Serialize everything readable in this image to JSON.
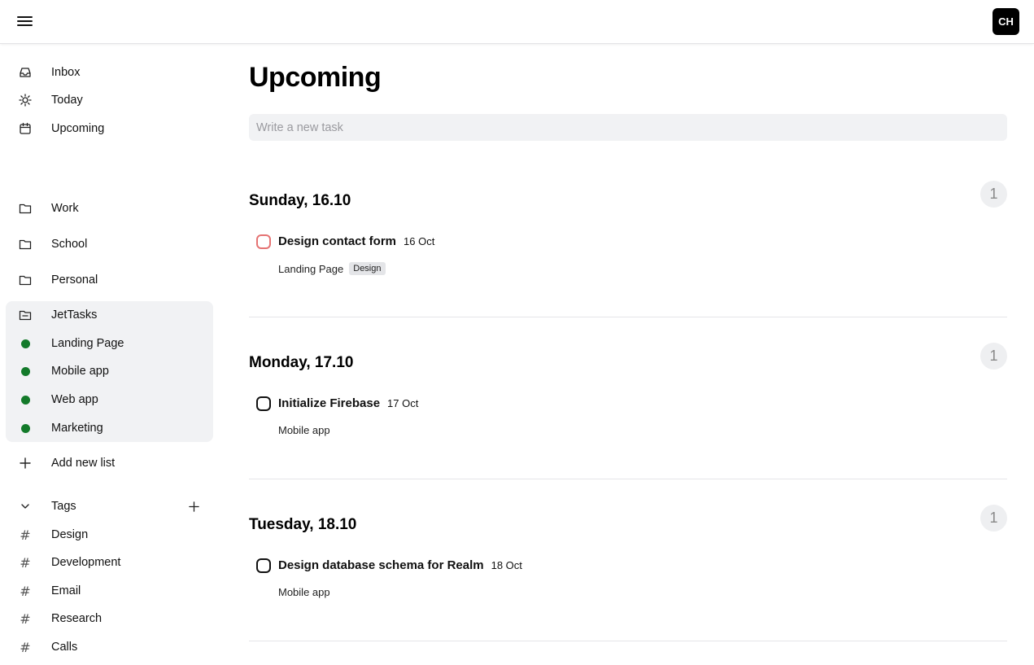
{
  "header": {
    "menu_icon": "hamburger-menu-icon",
    "avatar_initials": "CH"
  },
  "sidebar": {
    "nav": [
      {
        "label": "Inbox",
        "icon": "inbox-icon"
      },
      {
        "label": "Today",
        "icon": "sun-icon"
      },
      {
        "label": "Upcoming",
        "icon": "calendar-icon"
      }
    ],
    "lists": [
      {
        "label": "Work",
        "icon": "folder-icon"
      },
      {
        "label": "School",
        "icon": "folder-icon"
      },
      {
        "label": "Personal",
        "icon": "folder-icon"
      }
    ],
    "project": {
      "label": "JetTasks",
      "icon": "folder-open-icon",
      "items": [
        {
          "label": "Landing Page",
          "color": "#137a2a"
        },
        {
          "label": "Mobile app",
          "color": "#137a2a"
        },
        {
          "label": "Web app",
          "color": "#137a2a"
        },
        {
          "label": "Marketing",
          "color": "#137a2a"
        }
      ]
    },
    "add_list_label": "Add new list",
    "tags": {
      "label": "Tags",
      "items": [
        "Design",
        "Development",
        "Email",
        "Research",
        "Calls"
      ]
    }
  },
  "main": {
    "title": "Upcoming",
    "new_task_placeholder": "Write a new task",
    "sections": [
      {
        "title": "Sunday, 16.10",
        "count": "1",
        "task": {
          "title": "Design contact form",
          "date": "16 Oct",
          "list": "Landing Page",
          "tag": "Design",
          "checkbox_color": "#e57373"
        }
      },
      {
        "title": "Monday, 17.10",
        "count": "1",
        "task": {
          "title": "Initialize Firebase",
          "date": "17 Oct",
          "list": "Mobile app"
        }
      },
      {
        "title": "Tuesday, 18.10",
        "count": "1",
        "task": {
          "title": "Design database schema for Realm",
          "date": "18 Oct",
          "list": "Mobile app"
        }
      }
    ]
  }
}
